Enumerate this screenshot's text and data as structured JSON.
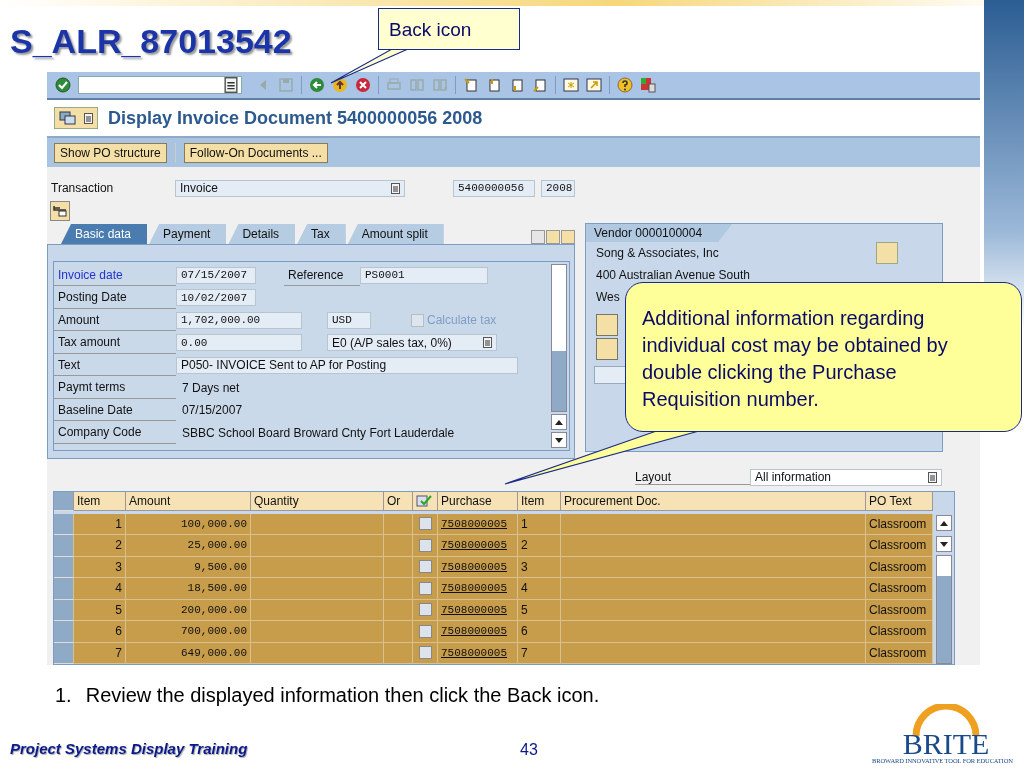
{
  "slide": {
    "title": "S_ALR_87013542",
    "footer": "Project Systems Display Training",
    "page_number": "43",
    "logo": {
      "name": "BRITE",
      "tagline": "BROWARD INNOVATIVE TOOL FOR EDUCATION"
    }
  },
  "callouts": [
    {
      "kind": "small",
      "text": "Back icon"
    },
    {
      "kind": "large",
      "text": "Additional information regarding individual cost may be obtained by double clicking the Purchase Requisition number."
    }
  ],
  "window": {
    "title": "Display Invoice Document 5400000056 2008"
  },
  "app_toolbar": [
    "Show PO structure",
    "Follow-On Documents ..."
  ],
  "header": {
    "transaction_label": "Transaction",
    "transaction": "Invoice",
    "document_number": "5400000056",
    "fiscal_year": "2008"
  },
  "tabs": [
    {
      "label": "Basic data",
      "selected": true
    },
    {
      "label": "Payment",
      "selected": false
    },
    {
      "label": "Details",
      "selected": false
    },
    {
      "label": "Tax",
      "selected": false
    },
    {
      "label": "Amount split",
      "selected": false
    }
  ],
  "basic_data": {
    "rows": [
      {
        "label": "Invoice date",
        "focused": true,
        "value": {
          "kind": "date",
          "text": "07/15/2007"
        },
        "extra": {
          "label": "Reference",
          "value": {
            "kind": "long",
            "text": "PS0001"
          }
        }
      },
      {
        "label": "Posting Date",
        "focused": false,
        "value": {
          "kind": "date",
          "text": "10/02/2007"
        }
      },
      {
        "label": "Amount",
        "focused": false,
        "value": {
          "kind": "amount",
          "text": "1,702,000.00"
        },
        "extra": {
          "value": {
            "kind": "currency",
            "text": "USD"
          },
          "checkbox": {
            "label": "Calculate tax",
            "checked": false,
            "disabled": true
          }
        }
      },
      {
        "label": "Tax amount",
        "focused": false,
        "value": {
          "kind": "amount",
          "text": "0.00"
        },
        "extra": {
          "value": {
            "kind": "dropdown",
            "text": "E0 (A/P sales tax, 0%)"
          }
        }
      },
      {
        "label": "Text",
        "focused": false,
        "value": {
          "kind": "wide",
          "text": "P050- INVOICE Sent to AP for Posting"
        }
      },
      {
        "label": "Paymt terms",
        "focused": false,
        "value": {
          "kind": "plain",
          "text": "7 Days net"
        }
      },
      {
        "label": "Baseline Date",
        "focused": false,
        "value": {
          "kind": "plain",
          "text": "07/15/2007"
        }
      },
      {
        "label": "Company Code",
        "focused": false,
        "value": {
          "kind": "plain",
          "text": "SBBC School Board Broward Cnty Fort Lauderdale"
        }
      }
    ]
  },
  "vendor": {
    "title": "Vendor 0000100004",
    "lines": [
      "Song & Associates, Inc",
      "400 Australian Avenue South",
      "Wes"
    ]
  },
  "layout": {
    "label": "Layout",
    "value": "All information"
  },
  "table": {
    "columns": [
      {
        "kind": "text",
        "label": "Item"
      },
      {
        "kind": "text",
        "label": "Amount"
      },
      {
        "kind": "text",
        "label": "Quantity"
      },
      {
        "kind": "text",
        "label": "Or"
      },
      {
        "kind": "icon"
      },
      {
        "kind": "text",
        "label": "Purchase"
      },
      {
        "kind": "text",
        "label": "Item"
      },
      {
        "kind": "text",
        "label": "Procurement Doc."
      },
      {
        "kind": "text",
        "label": "PO Text"
      }
    ],
    "rows": [
      {
        "item": "1",
        "amount": "100,000.00",
        "checked": false,
        "purchase": "7508000005",
        "po_item": "1",
        "po_text": "Classroom"
      },
      {
        "item": "2",
        "amount": "25,000.00",
        "checked": false,
        "purchase": "7508000005",
        "po_item": "2",
        "po_text": "Classroom"
      },
      {
        "item": "3",
        "amount": "9,500.00",
        "checked": false,
        "purchase": "7508000005",
        "po_item": "3",
        "po_text": "Classroom"
      },
      {
        "item": "4",
        "amount": "18,500.00",
        "checked": false,
        "purchase": "7508000005",
        "po_item": "4",
        "po_text": "Classroom"
      },
      {
        "item": "5",
        "amount": "200,000.00",
        "checked": false,
        "purchase": "7508000005",
        "po_item": "5",
        "po_text": "Classroom"
      },
      {
        "item": "6",
        "amount": "700,000.00",
        "checked": false,
        "purchase": "7508000005",
        "po_item": "6",
        "po_text": "Classroom"
      },
      {
        "item": "7",
        "amount": "649,000.00",
        "checked": false,
        "purchase": "7508000005",
        "po_item": "7",
        "po_text": "Classroom"
      }
    ]
  },
  "instruction": {
    "number": "1.",
    "text": "Review the displayed information then click the Back icon."
  }
}
